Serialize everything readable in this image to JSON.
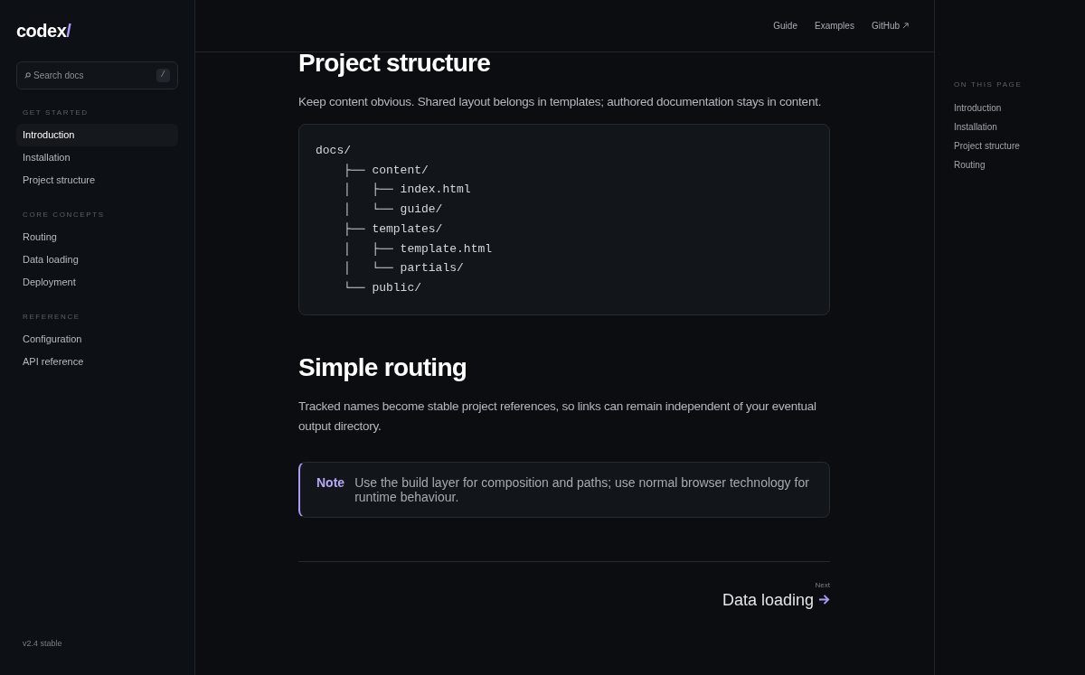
{
  "logo": {
    "text": "codex",
    "mark": "/"
  },
  "search": {
    "placeholder": "Search docs",
    "shortcut": "/"
  },
  "sidebar": {
    "sections": [
      {
        "title": "GET STARTED",
        "items": [
          {
            "label": "Introduction",
            "selected": true
          },
          {
            "label": "Installation",
            "selected": false
          },
          {
            "label": "Project structure",
            "selected": false
          }
        ]
      },
      {
        "title": "CORE CONCEPTS",
        "items": [
          {
            "label": "Routing",
            "selected": false
          },
          {
            "label": "Data loading",
            "selected": false
          },
          {
            "label": "Deployment",
            "selected": false
          }
        ]
      },
      {
        "title": "REFERENCE",
        "items": [
          {
            "label": "Configuration",
            "selected": false
          },
          {
            "label": "API reference",
            "selected": false
          }
        ]
      }
    ],
    "version": "v2.4 stable"
  },
  "top_nav": [
    {
      "label": "Guide",
      "external": false
    },
    {
      "label": "Examples",
      "external": false
    },
    {
      "label": "GitHub",
      "external": true
    }
  ],
  "content": {
    "sections": [
      {
        "heading": "Project structure",
        "paragraph": "Keep content obvious. Shared layout belongs in templates; authored documentation stays in content.",
        "code": "docs/\n    ├── content/\n    │   ├── index.html\n    │   └── guide/\n    ├── templates/\n    │   ├── template.html\n    │   └── partials/\n    └── public/"
      },
      {
        "heading": "Simple routing",
        "paragraph": "Tracked names become stable project references, so links can remain independent of your eventual output directory.",
        "note": {
          "label": "Note",
          "text": "Use the build layer for composition and paths; use normal browser technology for runtime behaviour."
        }
      }
    ],
    "next": {
      "caption": "Next",
      "title": "Data loading"
    }
  },
  "toc": {
    "title": "ON THIS PAGE",
    "items": [
      "Introduction",
      "Installation",
      "Project structure",
      "Routing"
    ]
  }
}
